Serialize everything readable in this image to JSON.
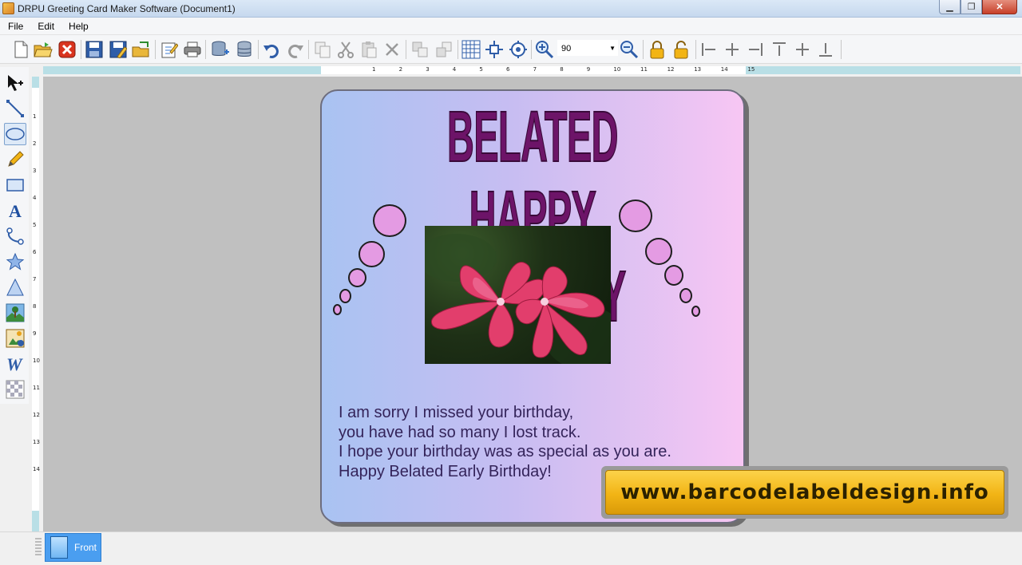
{
  "window": {
    "title": "DRPU Greeting Card Maker Software  (Document1)",
    "minimize_glyph": "▁",
    "maximize_glyph": "❐",
    "close_glyph": "✕"
  },
  "menu": [
    "File",
    "Edit",
    "Help"
  ],
  "toolbar": {
    "zoom_value": "90",
    "tools": [
      "new-icon",
      "open-icon",
      "close-icon",
      "save-icon",
      "save-as-icon",
      "export-icon",
      "edit-icon",
      "print-icon",
      "database-add-icon",
      "database-icon",
      "undo-icon",
      "redo-icon",
      "copy-icon",
      "cut-icon",
      "paste-icon",
      "delete-icon",
      "bring-front-icon",
      "send-back-icon",
      "grid-icon",
      "fit-icon",
      "zoom-settings-icon",
      "zoom-in-icon",
      "zoom-out-icon",
      "lock-icon",
      "unlock-icon",
      "align-left-icon",
      "align-center-icon",
      "align-right-icon",
      "align-top-icon",
      "align-middle-icon",
      "align-bottom-icon"
    ]
  },
  "left_tools": [
    "select-tool",
    "line-tool",
    "ellipse-tool",
    "pencil-tool",
    "rectangle-tool",
    "text-tool",
    "arc-tool",
    "star-tool",
    "triangle-tool",
    "image-tool",
    "picture-tool",
    "word-art-tool",
    "background-tool"
  ],
  "ruler": {
    "h_labels": [
      "1",
      "2",
      "3",
      "4",
      "5",
      "6",
      "7",
      "8",
      "9",
      "10",
      "11",
      "12",
      "13",
      "14",
      "15"
    ],
    "v_labels": [
      "1",
      "2",
      "3",
      "4",
      "5",
      "6",
      "7",
      "8",
      "9",
      "10",
      "11",
      "12",
      "13",
      "14"
    ]
  },
  "card": {
    "title": "BELATED HAPPY BIRTHDAY",
    "title_color": "#6d1468",
    "message_lines": [
      "I am sorry I missed your birthday,",
      "you have had so many I lost track.",
      "I hope your birthday was as special as you are.",
      "Happy Belated Early Birthday!"
    ],
    "photo_subject": "pink plumeria flowers"
  },
  "watermark": "www.barcodelabeldesign.info",
  "pages": [
    {
      "label": "Front"
    }
  ]
}
